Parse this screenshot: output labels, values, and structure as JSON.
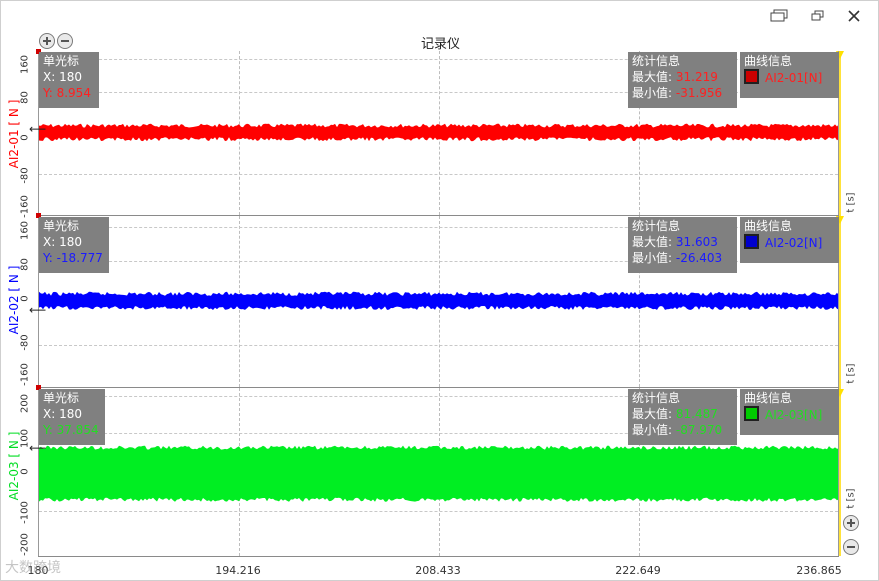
{
  "window": {
    "title": "记录仪",
    "buttons": [
      "restore",
      "maximize",
      "close"
    ]
  },
  "x_axis": {
    "ticks": [
      "180",
      "194.216",
      "208.433",
      "222.649",
      "236.865"
    ],
    "unit_label": "t [s]"
  },
  "channels": [
    {
      "name": "AI2-01  [ N ]",
      "color": "#ff0000",
      "swatch": "#cc0000",
      "yticks": [
        "160",
        "80",
        "0",
        "-80",
        "-160"
      ],
      "cursor": {
        "title": "单光标",
        "x": "X: 180",
        "y": "Y: 8.954"
      },
      "stats": {
        "title": "统计信息",
        "max_label": "最大值:",
        "max": "31.219",
        "min_label": "最小值:",
        "min": "-31.956"
      },
      "curve": {
        "title": "曲线信息",
        "label": "AI2-01[N]"
      },
      "band": {
        "low": -17,
        "high": 20
      }
    },
    {
      "name": "AI2-02  [ N ]",
      "color": "#0000ff",
      "swatch": "#0000cc",
      "yticks": [
        "160",
        "80",
        "0",
        "-80",
        "-160"
      ],
      "cursor": {
        "title": "单光标",
        "x": "X: 180",
        "y": "Y: -18.777"
      },
      "stats": {
        "title": "统计信息",
        "max_label": "最大值:",
        "max": "31.603",
        "min_label": "最小值:",
        "min": "-26.403"
      },
      "curve": {
        "title": "曲线信息",
        "label": "AI2-02[N]"
      },
      "band": {
        "low": -17,
        "high": 20
      }
    },
    {
      "name": "AI2-03  [ N ]",
      "color": "#00ee22",
      "swatch": "#00cc00",
      "yticks": [
        "200",
        "100",
        "0",
        "-100",
        "-200"
      ],
      "cursor": {
        "title": "单光标",
        "x": "X: 180",
        "y": "Y: 37.854"
      },
      "stats": {
        "title": "统计信息",
        "max_label": "最大值:",
        "max": "81.487",
        "min_label": "最小值:",
        "min": "-87.970"
      },
      "curve": {
        "title": "曲线信息",
        "label": "AI2-03[N]"
      },
      "band": {
        "low": -85,
        "high": 75
      }
    }
  ],
  "watermark": "大数跨境"
}
